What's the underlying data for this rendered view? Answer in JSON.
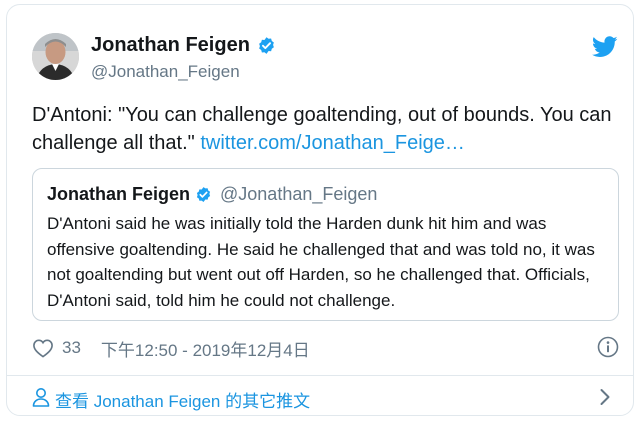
{
  "author": {
    "name": "Jonathan Feigen",
    "handle": "@Jonathan_Feigen"
  },
  "tweet": {
    "text": "D'Antoni: \"You can challenge goaltending, out of bounds. You can challenge all that.\" ",
    "link": "twitter.com/Jonathan_Feige…"
  },
  "quoted_tweet": {
    "name": "Jonathan Feigen",
    "handle": "@Jonathan_Feigen",
    "text": "D'Antoni said he was initially told the Harden dunk hit him and was offensive goaltending. He said he challenged that and was told no, it was not goaltending but went out off Harden, so he challenged that. Officials, D'Antoni said, told him he could not challenge."
  },
  "meta": {
    "like_count": "33",
    "timestamp": "下午12:50 - 2019年12月4日"
  },
  "footer": {
    "label": "查看 Jonathan Feigen 的其它推文"
  },
  "colors": {
    "link": "#1b95e0",
    "secondary_text": "#657786",
    "border": "#e1e8ed",
    "verified": "#1da1f2"
  },
  "icons": [
    "verified-badge-icon",
    "twitter-bird-icon",
    "heart-icon",
    "info-icon",
    "person-icon",
    "chevron-right-icon"
  ]
}
